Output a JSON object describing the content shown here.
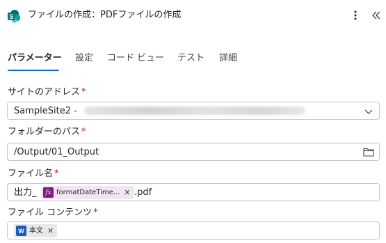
{
  "header": {
    "title": "ファイルの作成：PDFファイルの作成",
    "app_icon": "sharepoint-icon",
    "more_icon": "more-vertical-icon",
    "collapse_icon": "double-chevron-left-icon"
  },
  "tabs": [
    {
      "label": "パラメーター",
      "active": true
    },
    {
      "label": "設定",
      "active": false
    },
    {
      "label": "コード ビュー",
      "active": false
    },
    {
      "label": "テスト",
      "active": false
    },
    {
      "label": "詳細",
      "active": false
    }
  ],
  "fields": {
    "site_address": {
      "label": "サイトのアドレス",
      "required_mark": "*",
      "value": "SampleSite2 -",
      "icon": "chevron-down-icon"
    },
    "folder_path": {
      "label": "フォルダーのパス",
      "required_mark": "*",
      "value": "/Output/01_Output",
      "icon": "folder-icon"
    },
    "file_name": {
      "label": "ファイル名",
      "required_mark": "*",
      "prefix": "出力_",
      "token": {
        "icon": "fx",
        "label": "formatDateTime...",
        "close": "✕"
      },
      "suffix": ".pdf"
    },
    "file_content": {
      "label": "ファイル コンテンツ",
      "required_mark": "*",
      "token": {
        "icon": "W",
        "label": "本文",
        "close": "✕"
      }
    }
  },
  "colors": {
    "accent": "#0f6cbd",
    "required": "#c50f1f",
    "expression_token_bg": "#f3e4f4",
    "expression_icon": "#7a1d81",
    "word_icon": "#185abd"
  }
}
